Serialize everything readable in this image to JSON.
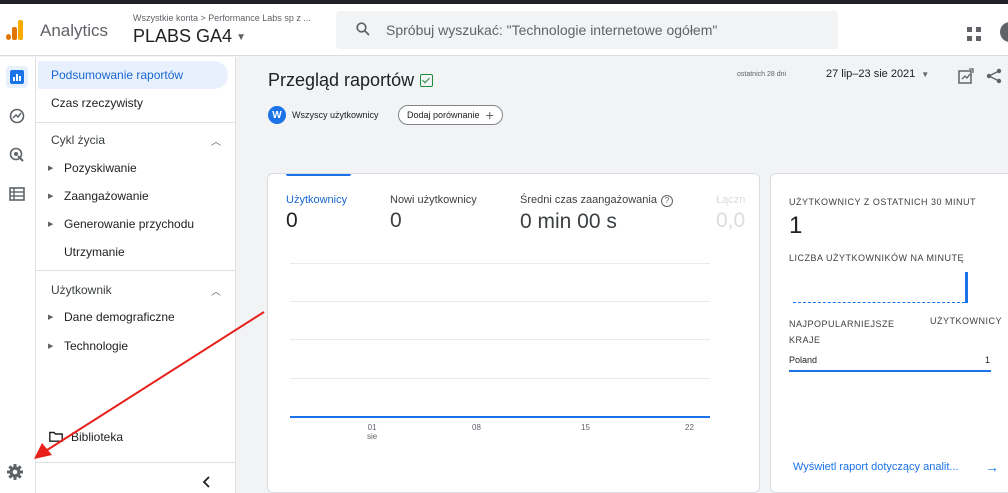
{
  "header": {
    "app_name": "Analytics",
    "account_path": "Wszystkie konta > Performance Labs sp z ...",
    "property_name": "PLABS GA4",
    "search_placeholder": "Spróbuj wyszukać: \"Technologie internetowe ogółem\""
  },
  "nav": {
    "items": [
      {
        "label": "Podsumowanie raportów",
        "active": true
      },
      {
        "label": "Czas rzeczywisty"
      }
    ],
    "section_lifecycle": "Cykl życia",
    "lifecycle_items": [
      "Pozyskiwanie",
      "Zaangażowanie",
      "Generowanie przychodu",
      "Utrzymanie"
    ],
    "section_user": "Użytkownik",
    "user_items": [
      "Dane demograficzne",
      "Technologie"
    ],
    "library": "Biblioteka"
  },
  "main": {
    "title": "Przegląd raportów",
    "date_prefix": "ostatnich 28 dni",
    "date_range": "27 lip–23 sie 2021",
    "segment_badge": "W",
    "segment_label": "Wszyscy użytkownicy",
    "compare_label": "Dodaj porównanie",
    "metrics": [
      {
        "label": "Użytkownicy",
        "value": "0"
      },
      {
        "label": "Nowi użytkownicy",
        "value": "0"
      },
      {
        "label": "Średni czas zaangażowania",
        "value": "0 min 00 s"
      },
      {
        "label": "Łączn",
        "value": "0,0"
      }
    ],
    "x_ticks": [
      {
        "top": "01",
        "bottom": "sie"
      },
      {
        "top": "08",
        "bottom": ""
      },
      {
        "top": "15",
        "bottom": ""
      },
      {
        "top": "22",
        "bottom": ""
      }
    ]
  },
  "chart_data": {
    "type": "line",
    "x": [
      "01 sie",
      "08",
      "15",
      "22"
    ],
    "series": [
      {
        "name": "Użytkownicy",
        "values": [
          0,
          0,
          0,
          0
        ]
      }
    ],
    "ylim": [
      0,
      1
    ],
    "grid": true
  },
  "realtime": {
    "title": "UŻYTKOWNICY Z OSTATNICH 30 MINUT",
    "value": "1",
    "per_minute_label": "LICZBA UŻYTKOWNIKÓW NA MINUTĘ",
    "col_country": "NAJPOPULARNIEJSZE KRAJE",
    "col_users": "UŻYTKOWNICY",
    "rows": [
      {
        "country": "Poland",
        "users": "1"
      }
    ],
    "link": "Wyświetl raport dotyczący analit..."
  },
  "colors": {
    "accent": "#1a73e8",
    "active_bg": "#e8f0fe",
    "annotation": "#e8201c"
  }
}
